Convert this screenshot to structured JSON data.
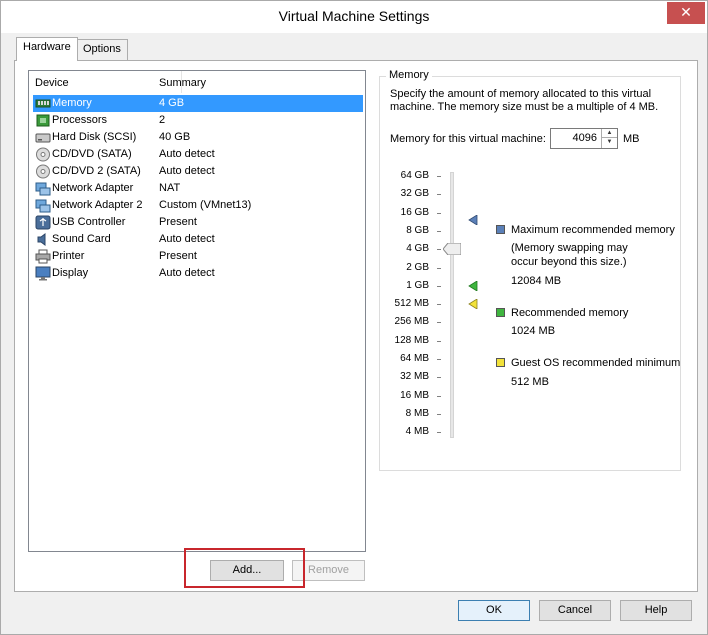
{
  "window": {
    "title": "Virtual Machine Settings"
  },
  "tabs": [
    {
      "label": "Hardware",
      "active": true
    },
    {
      "label": "Options",
      "active": false
    }
  ],
  "device_list": {
    "columns": [
      "Device",
      "Summary"
    ],
    "rows": [
      {
        "icon": "memory-icon",
        "device": "Memory",
        "summary": "4 GB",
        "selected": true
      },
      {
        "icon": "processor-icon",
        "device": "Processors",
        "summary": "2"
      },
      {
        "icon": "hard-disk-icon",
        "device": "Hard Disk (SCSI)",
        "summary": "40 GB"
      },
      {
        "icon": "cd-dvd-icon",
        "device": "CD/DVD (SATA)",
        "summary": "Auto detect"
      },
      {
        "icon": "cd-dvd-icon",
        "device": "CD/DVD 2 (SATA)",
        "summary": "Auto detect"
      },
      {
        "icon": "network-adapter-icon",
        "device": "Network Adapter",
        "summary": "NAT"
      },
      {
        "icon": "network-adapter-icon",
        "device": "Network Adapter 2",
        "summary": "Custom (VMnet13)"
      },
      {
        "icon": "usb-icon",
        "device": "USB Controller",
        "summary": "Present"
      },
      {
        "icon": "sound-card-icon",
        "device": "Sound Card",
        "summary": "Auto detect"
      },
      {
        "icon": "printer-icon",
        "device": "Printer",
        "summary": "Present"
      },
      {
        "icon": "display-icon",
        "device": "Display",
        "summary": "Auto detect"
      }
    ]
  },
  "buttons": {
    "add": "Add...",
    "remove": "Remove",
    "ok": "OK",
    "cancel": "Cancel",
    "help": "Help"
  },
  "memory": {
    "group_label": "Memory",
    "description": "Specify the amount of memory allocated to this virtual machine. The memory size must be a multiple of 4 MB.",
    "field_label": "Memory for this virtual machine:",
    "value": "4096",
    "unit": "MB",
    "slider_value": "4 GB",
    "scale": [
      "64 GB",
      "32 GB",
      "16 GB",
      "8 GB",
      "4 GB",
      "2 GB",
      "1 GB",
      "512 MB",
      "256 MB",
      "128 MB",
      "64 MB",
      "32 MB",
      "16 MB",
      "8 MB",
      "4 MB"
    ],
    "legend": {
      "max": {
        "label": "Maximum recommended memory",
        "note": "(Memory swapping may occur beyond this size.)",
        "value": "12084 MB",
        "color": "#5b80b8"
      },
      "recommended": {
        "label": "Recommended memory",
        "value": "1024 MB",
        "color": "#3fb53f"
      },
      "guest_min": {
        "label": "Guest OS recommended minimum",
        "value": "512 MB",
        "color": "#f2e23a"
      }
    }
  },
  "colors": {
    "selection": "#3399ff",
    "close_button": "#c75050",
    "highlight_box": "#c8262c"
  }
}
